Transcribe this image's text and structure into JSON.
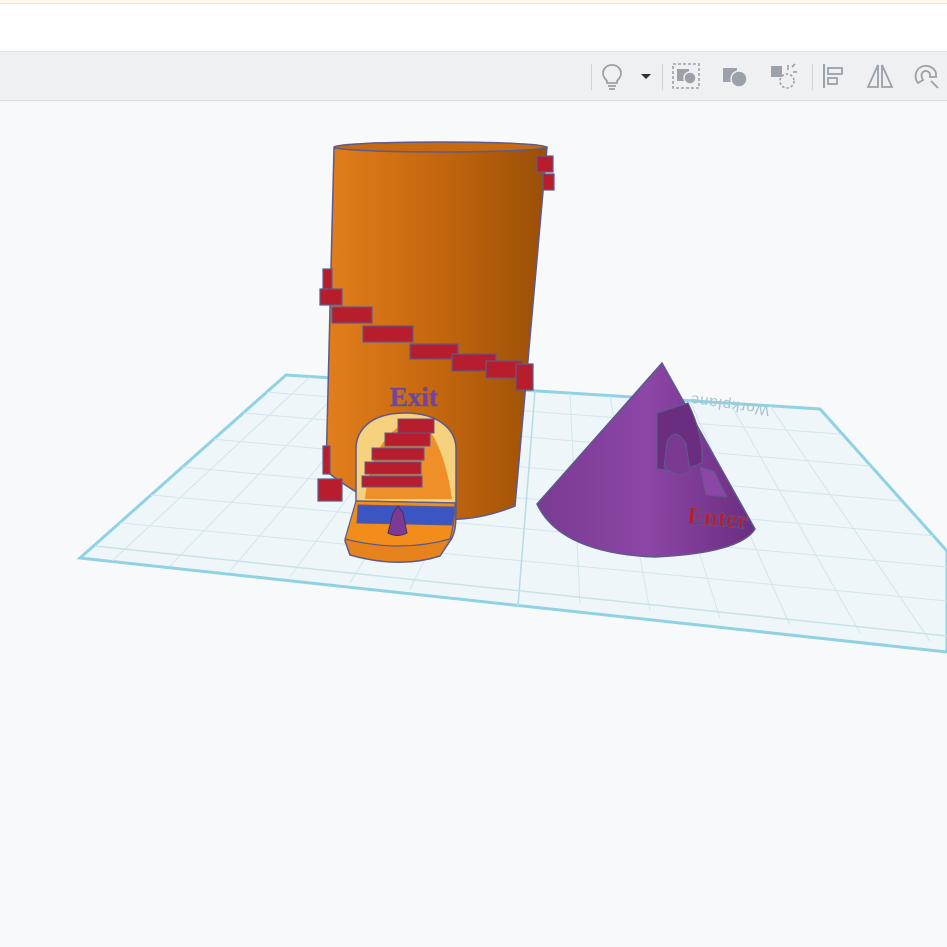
{
  "toolbar": {
    "buttons": [
      {
        "name": "lightbulb-icon",
        "label": "Lights"
      },
      {
        "name": "dropdown-caret-icon",
        "label": "Light options"
      },
      {
        "name": "group-icon",
        "label": "Group"
      },
      {
        "name": "ungroup-icon",
        "label": "Ungroup"
      },
      {
        "name": "hole-icon",
        "label": "Hole"
      },
      {
        "name": "align-icon",
        "label": "Align"
      },
      {
        "name": "mirror-icon",
        "label": "Mirror"
      },
      {
        "name": "cruise-magnet-icon",
        "label": "Cruise"
      }
    ]
  },
  "workplane": {
    "label": "Workplane"
  },
  "scene": {
    "tower": {
      "color": "#c0650d",
      "text": "Exit"
    },
    "cone": {
      "color": "#7d3a95",
      "text": "Enter"
    },
    "stairs_color": "#b81d2e",
    "ramp_color": "#f28c1a",
    "carpet_color": "#3b55c2"
  },
  "colors": {
    "workplane_fill": "#eef6f9",
    "workplane_edge": "#8fd2e4",
    "grid_line": "#cfe3ea"
  }
}
